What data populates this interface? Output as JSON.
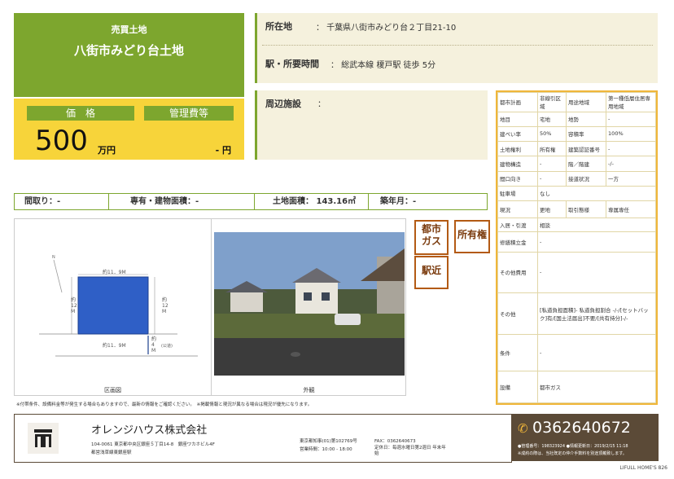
{
  "header": {
    "type_label": "売買土地",
    "title": "八街市みどり台土地"
  },
  "price": {
    "label": "価　格",
    "value": "500",
    "unit": "万円",
    "fee_label": "管理費等",
    "fee_value": "- 円"
  },
  "location": {
    "label": "所在地",
    "value": "： 千葉県八街市みどり台２丁目21-10"
  },
  "access": {
    "label": "駅・所要時間",
    "value": "： 総武本線 榎戸駅 徒歩 5分"
  },
  "facilities": {
    "label": "周辺施設",
    "value": "："
  },
  "summary": {
    "layout": "間取り：-",
    "area": "専有・建物面積：-",
    "land": "土地面積： 143.16㎡",
    "age": "築年月：-"
  },
  "spec": [
    {
      "k": "都市計画",
      "v": "非線引区域",
      "k2": "用途地域",
      "v2": "第一種低層住居専用地域"
    },
    {
      "k": "地目",
      "v": "宅地",
      "k2": "地勢",
      "v2": "-"
    },
    {
      "k": "建ぺい率",
      "v": "50%",
      "k2": "容積率",
      "v2": "100%"
    },
    {
      "k": "土地権利",
      "v": "所有権",
      "k2": "建築認証番号",
      "v2": "-"
    },
    {
      "k": "建物構造",
      "v": "-",
      "k2": "階／階建",
      "v2": "-/-"
    },
    {
      "k": "間口向き",
      "v": "-",
      "k2": "接道状況",
      "v2": "一方"
    },
    {
      "k": "駐車場",
      "v": "なし"
    },
    {
      "k": "現況",
      "v": "更地",
      "k2": "取引態様",
      "v2": "専属専任"
    },
    {
      "k": "入居・引渡",
      "v": "相談"
    },
    {
      "k": "修繕積立金",
      "v": "-"
    },
    {
      "k": "その他費用",
      "v": "-"
    },
    {
      "k": "その他",
      "v": "[私道負担面積]- 私道負担割合 -/-/[セットバック]有/[国土法届出]不要/[共有持分]-/-"
    },
    {
      "k": "条件",
      "v": "-"
    },
    {
      "k": "設備",
      "v": "都市ガス"
    }
  ],
  "stamps": {
    "gas": "都市\nガス",
    "own": "所有権",
    "station": "駅近"
  },
  "plan": {
    "dim_top": "約11．9M",
    "dim_bottom": "約11．9M",
    "dim_left": "約12M",
    "dim_right": "約12M",
    "road": "約4M",
    "road_type": "(公道)",
    "caption": "区画図"
  },
  "photo_caption": "外観",
  "notes": "※付帯条件、設備料金等が発生する場合もありますので、最新の情報をご確認ください。　※掲載情報と現況が異なる場合は現況が優先になります。",
  "company": {
    "name": "オレンジハウス株式会社",
    "address": "104-0061 東京都中央区銀座５丁目14-8　銀座ワカホビル4F",
    "station": "都営浅草線東銀座駅",
    "license": "東京都知事(01)第102769号",
    "hours": "営業時間：10:00 - 18:00",
    "fax": "FAX：0362640673",
    "holiday": "定休日：毎週水曜日第2週日 年末年始",
    "phone": "0362640672",
    "mgmt": "●管理番号：198323924 ●情報更新日：2019/2/15 11:18",
    "note": "※成約の際は、当社既定の仲介手数料を別途頂戴致します。"
  },
  "brand": "LIFULL HOME'S 826"
}
